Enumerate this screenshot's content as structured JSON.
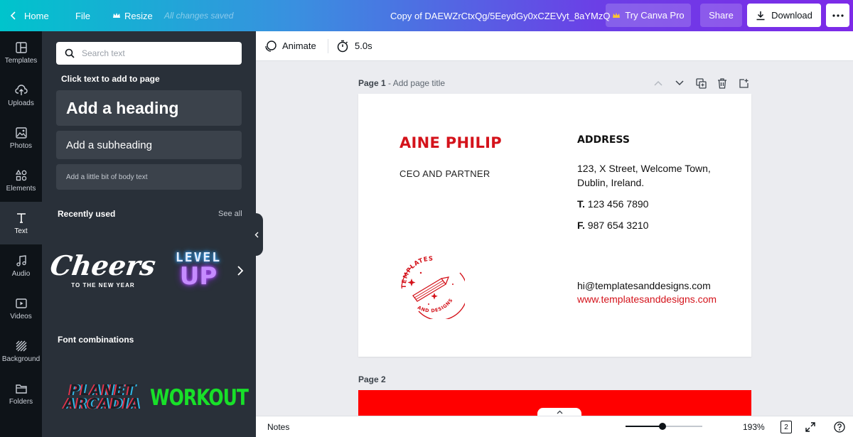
{
  "topbar": {
    "home_label": "Home",
    "file_label": "File",
    "resize_label": "Resize",
    "saved_status": "All changes saved",
    "doc_title": "Copy of DAEWZrCtxQg/5EeydGy0xCZEVyt_8aYMzQ",
    "pro_label": "Try Canva Pro",
    "share_label": "Share",
    "download_label": "Download"
  },
  "rail": {
    "items": [
      {
        "label": "Templates",
        "icon": "layout-icon"
      },
      {
        "label": "Uploads",
        "icon": "upload-cloud-icon"
      },
      {
        "label": "Photos",
        "icon": "image-icon"
      },
      {
        "label": "Elements",
        "icon": "shapes-icon"
      },
      {
        "label": "Text",
        "icon": "text-icon",
        "active": true
      },
      {
        "label": "Audio",
        "icon": "music-note-icon"
      },
      {
        "label": "Videos",
        "icon": "video-play-icon"
      },
      {
        "label": "Background",
        "icon": "hatch-pattern-icon"
      },
      {
        "label": "Folders",
        "icon": "folder-icon"
      }
    ]
  },
  "panel": {
    "search_placeholder": "Search text",
    "click_label": "Click text to add to page",
    "heading_label": "Add a heading",
    "subheading_label": "Add a subheading",
    "body_label": "Add a little bit of body text",
    "recent_label": "Recently used",
    "see_all_label": "See all",
    "recent_items": [
      {
        "main": "Cheers",
        "sub": "TO THE NEW YEAR"
      },
      {
        "main": "LEVEL",
        "sub": "UP"
      }
    ],
    "combos_label": "Font combinations",
    "combos": [
      {
        "line1": "PLANET",
        "line2": "ARCADIA"
      },
      {
        "line1": "WORKOUT"
      }
    ]
  },
  "toolbar": {
    "animate_label": "Animate",
    "duration": "5.0s"
  },
  "canvas": {
    "page1_label": "Page 1",
    "page1_title_placeholder": "- Add page title",
    "page2_label": "Page 2",
    "card": {
      "name": "AINE PHILIP",
      "role": "CEO AND PARTNER",
      "address_heading": "ADDRESS",
      "address": "123, X Street, Welcome Town, Dublin, Ireland.",
      "tel_prefix": "T.",
      "tel": "123 456 7890",
      "fax_prefix": "F.",
      "fax": "987 654 3210",
      "email": "hi@templatesanddesigns.com",
      "website": "www.templatesanddesigns.com",
      "logo_top": "TEMPLATES",
      "logo_bottom": "AND DESIGNS"
    },
    "accent_color": "#d4131b",
    "page2_color": "#ff0000"
  },
  "bottombar": {
    "notes_label": "Notes",
    "zoom_level": "193%",
    "zoom_fraction": 0.48,
    "page_count": "2"
  }
}
